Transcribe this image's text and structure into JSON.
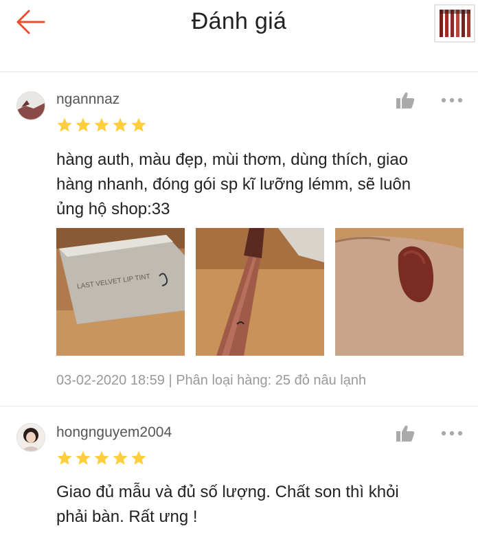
{
  "header": {
    "title": "Đánh giá",
    "back_icon": "arrow-left-icon",
    "accent_color": "#ee4d2d"
  },
  "reviews": [
    {
      "username": "ngannnaz",
      "rating": 5,
      "comment_lines": [
        "hàng auth, màu đẹp, mùi thơm, dùng thích, giao",
        "hàng nhanh, đóng gói sp kĩ lưỡng lémm, sẽ luôn",
        "ủng hộ shop:33"
      ],
      "photo_text": "LAST VELVET LIP TINT",
      "meta": "03-02-2020 18:59 | Phân loại hàng: 25 đỏ nâu lạnh"
    },
    {
      "username": "hongnguyem2004",
      "rating": 5,
      "comment_lines": [
        "Giao đủ mẫu và đủ số lượng. Chất son thì khỏi",
        "phải bàn. Rất ưng !"
      ]
    }
  ],
  "colors": {
    "star": "#ffce3d",
    "meta_text": "#999999",
    "icon_gray": "#aaaaaa"
  }
}
